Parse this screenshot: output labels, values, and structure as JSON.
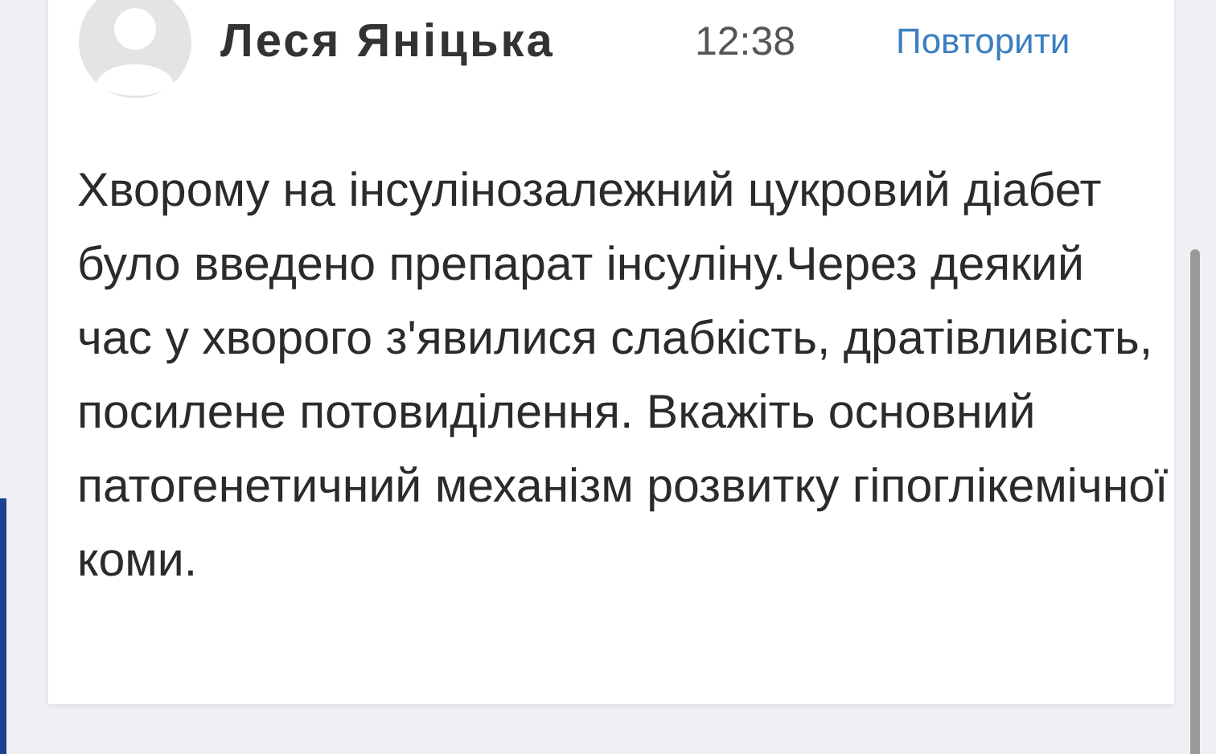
{
  "message": {
    "author": "Леся Яніцька",
    "time": "12:38",
    "action": "Повторити",
    "text": "Хворому на інсулінозалежний цукровий діабет було введено препарат інсуліну.Через деякий час у хворого з'явилися слабкість, дратівливість, посилене потовиділення. Вкажіть основний патогенетичний механізм розвитку гіпоглікемічної коми."
  }
}
